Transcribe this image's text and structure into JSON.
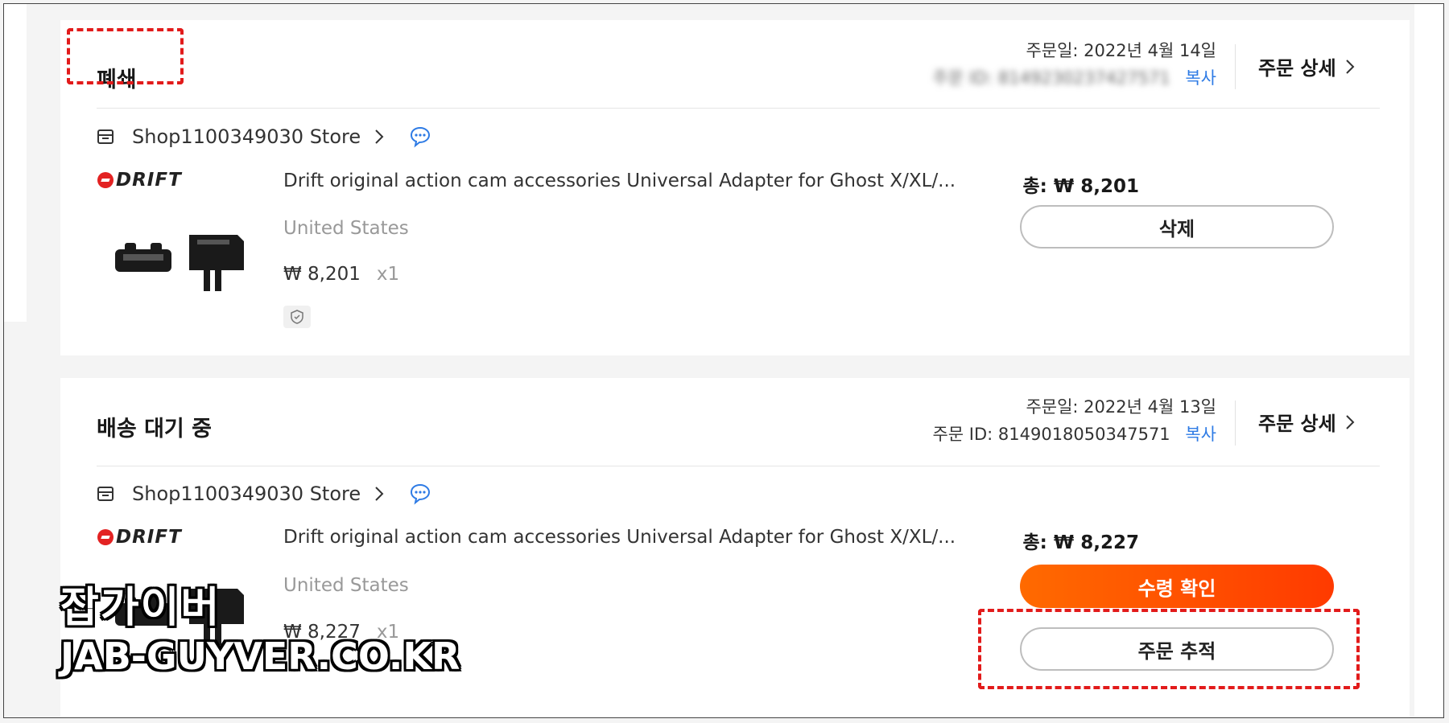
{
  "orders": [
    {
      "status": "폐쇄",
      "order_date": "주문일: 2022년 4월 14일",
      "order_id_label": "주문 ID:",
      "order_id": "8149230237427571",
      "copy_label": "복사",
      "detail_label": "주문 상세",
      "store_name": "Shop1100349030 Store",
      "brand": "DRIFT",
      "product_title": "Drift original action cam accessories Universal Adapter for Ghost X/XL/...",
      "country": "United States",
      "price": "₩ 8,201",
      "qty": "x1",
      "total_label": "총:",
      "total_value": "₩ 8,201",
      "buttons": [
        "삭제"
      ]
    },
    {
      "status": "배송 대기 중",
      "order_date": "주문일: 2022년 4월 13일",
      "order_id_label": "주문 ID:",
      "order_id": "8149018050347571",
      "copy_label": "복사",
      "detail_label": "주문 상세",
      "store_name": "Shop1100349030 Store",
      "brand": "DRIFT",
      "product_title": "Drift original action cam accessories Universal Adapter for Ghost X/XL/...",
      "country": "United States",
      "price": "₩ 8,227",
      "qty": "x1",
      "total_label": "총:",
      "total_value": "₩ 8,227",
      "buttons": [
        "수령 확인",
        "주문 추적"
      ]
    }
  ],
  "watermark": {
    "line1": "잡가이버",
    "line2": "JAB-GUYVER.CO.KR"
  },
  "colors": {
    "accent": "#ff4d00",
    "highlight_dash": "#e21b1b",
    "link": "#2e7be5"
  }
}
